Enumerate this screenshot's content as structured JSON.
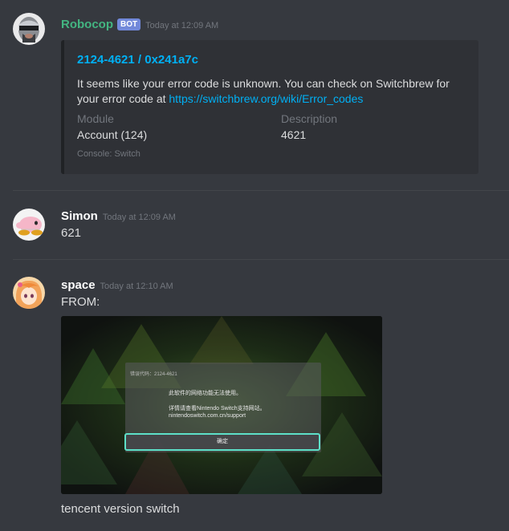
{
  "messages": [
    {
      "username": "Robocop",
      "username_color": "#43b581",
      "bot_tag": "BOT",
      "timestamp": "Today at 12:09 AM",
      "avatar": "robocop-avatar",
      "embed": {
        "title": "2124-4621 / 0x241a7c",
        "description_text": "It seems like your error code is unknown. You can check on Switchbrew for your error code at ",
        "description_link": "https://switchbrew.org/wiki/Error_codes",
        "fields": [
          {
            "name": "Module",
            "value": "Account (124)"
          },
          {
            "name": "Description",
            "value": "4621"
          }
        ],
        "footer": "Console: Switch"
      }
    },
    {
      "username": "Simon",
      "username_color": "#ffffff",
      "timestamp": "Today at 12:09 AM",
      "avatar": "kirby-avatar",
      "content": "621"
    },
    {
      "username": "space",
      "username_color": "#ffffff",
      "timestamp": "Today at 12:10 AM",
      "avatar": "anime-girl-avatar",
      "content": "FROM:",
      "attachment": {
        "error_code": "错误代码：2124-4621",
        "line1": "此软件的网络功能无法使用。",
        "line2": "详情请查看Nintendo Switch支持网站。",
        "line3": "nintendoswitch.com.cn/support",
        "button": "确定"
      },
      "caption": "tencent version switch"
    }
  ],
  "colors": {
    "background": "#36393f",
    "embed_bg": "#2f3136",
    "link": "#00b0f4",
    "bot_tag": "#7289da",
    "dialog_button_border": "#5de0c8"
  }
}
